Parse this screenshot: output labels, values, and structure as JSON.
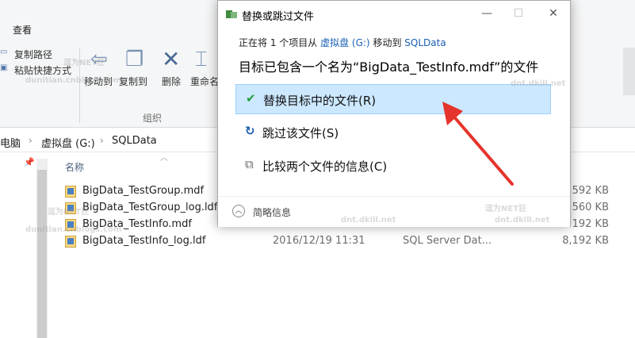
{
  "ribbon": {
    "tab_view": "查看",
    "copy_path": "复制路径",
    "paste_shortcut": "粘贴快捷方式",
    "move_to": "移动到",
    "copy_to": "复制到",
    "delete": "删除",
    "rename": "重命名",
    "group_organize": "组织"
  },
  "breadcrumb": [
    "电脑",
    "虚拟盘 (G:)",
    "SQLData"
  ],
  "columns": {
    "name": "名称"
  },
  "files": [
    {
      "name": "BigData_TestGroup.mdf",
      "date": "",
      "type": "",
      "size": "592 KB"
    },
    {
      "name": "BigData_TestGroup_log.ldf",
      "date": "",
      "type": "",
      "size": "560 KB"
    },
    {
      "name": "BigData_TestInfo.mdf",
      "date": "",
      "type": "",
      "size": "192 KB"
    },
    {
      "name": "BigData_TestInfo_log.ldf",
      "date": "2016/12/19 11:31",
      "type": "SQL Server Dat...",
      "size": "8,192 KB"
    }
  ],
  "dialog": {
    "title": "替换或跳过文件",
    "status_prefix": "正在将 1 个项目从",
    "status_source": "虚拟盘 (G:)",
    "status_mid": "移动到",
    "status_dest": "SQLData",
    "heading": "目标已包含一个名为“BigData_TestInfo.mdf”的文件",
    "options": [
      {
        "label": "替换目标中的文件(R)",
        "icon": "check-icon"
      },
      {
        "label": "跳过该文件(S)",
        "icon": "skip-icon"
      },
      {
        "label": "比较两个文件的信息(C)",
        "icon": "compare-icon"
      }
    ],
    "details_label": "简略信息",
    "minimize": "—",
    "maximize": "☐",
    "close": "✕"
  },
  "colors": {
    "accent": "#1a5fb4",
    "selected_bg": "#cce8ff",
    "check": "#1e9c3c",
    "arrow": "#e5342b"
  },
  "watermark": {
    "line1": "逗为NET狂",
    "line2": "dnt.dkill.net",
    "line3": "dunitian.cnblogs.com"
  }
}
